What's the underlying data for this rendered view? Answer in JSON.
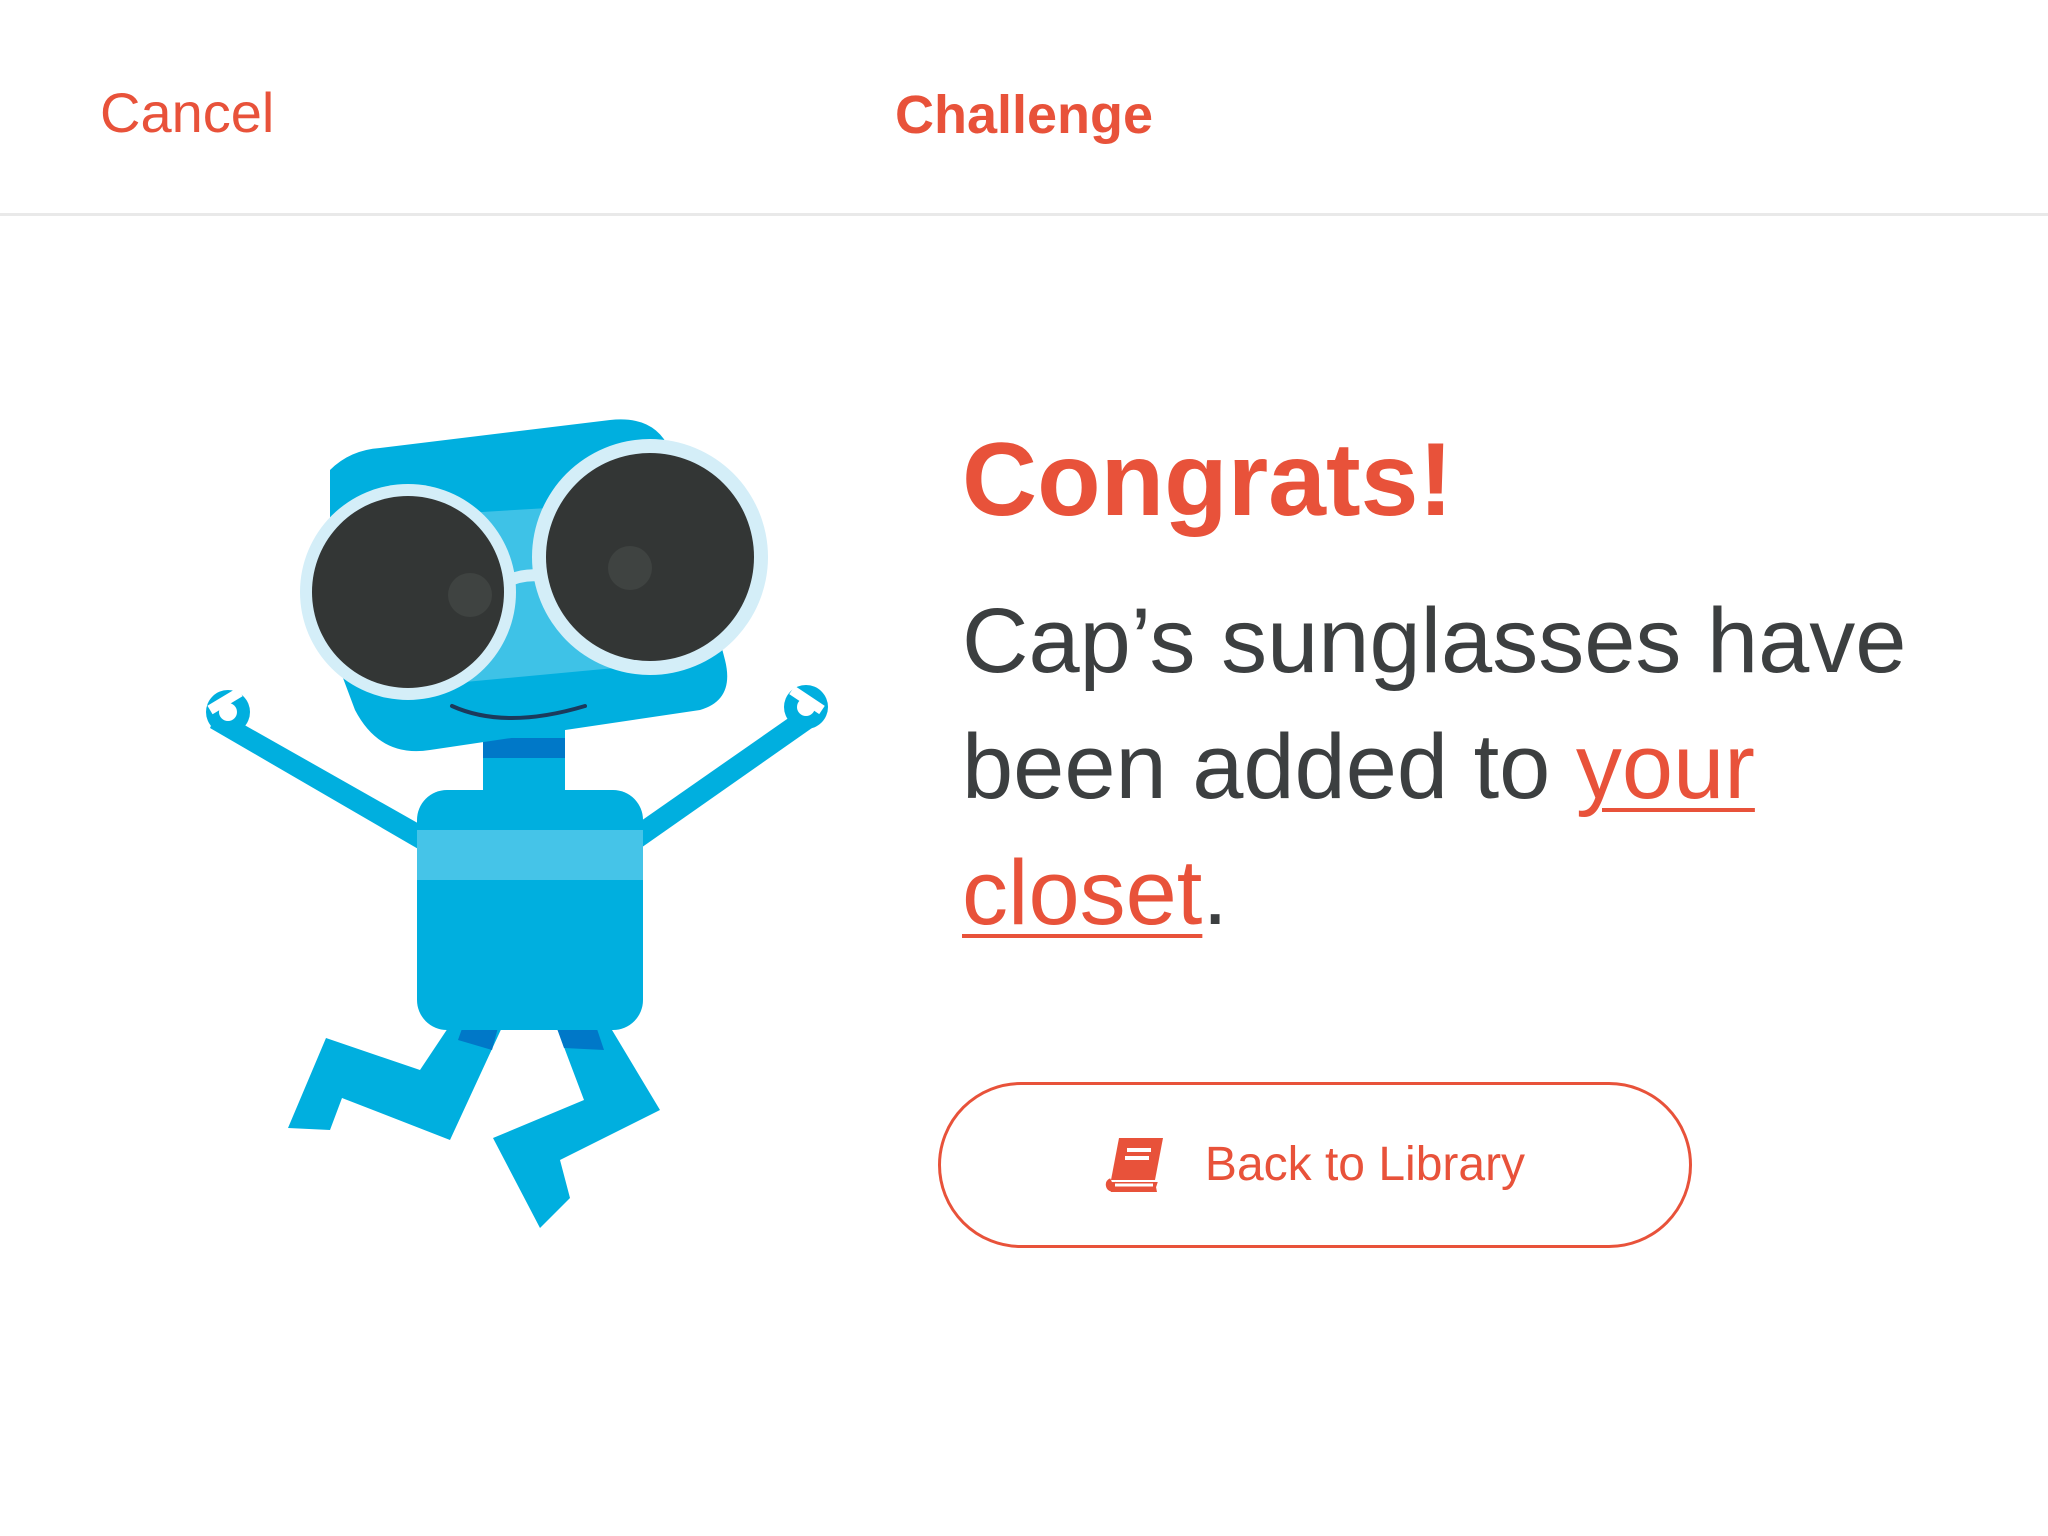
{
  "navbar": {
    "cancel_label": "Cancel",
    "title": "Challenge"
  },
  "main": {
    "heading": "Congrats!",
    "message_prefix": "Cap’s sunglasses have been added to ",
    "message_link": "your closet",
    "message_suffix": ".",
    "back_button_label": "Back to Library",
    "back_button_icon": "book-icon"
  },
  "colors": {
    "accent": "#e8523a",
    "text": "#3c3f40",
    "mascot_blue": "#00afdf",
    "lens": "#333635",
    "frame": "#d4eef8"
  }
}
